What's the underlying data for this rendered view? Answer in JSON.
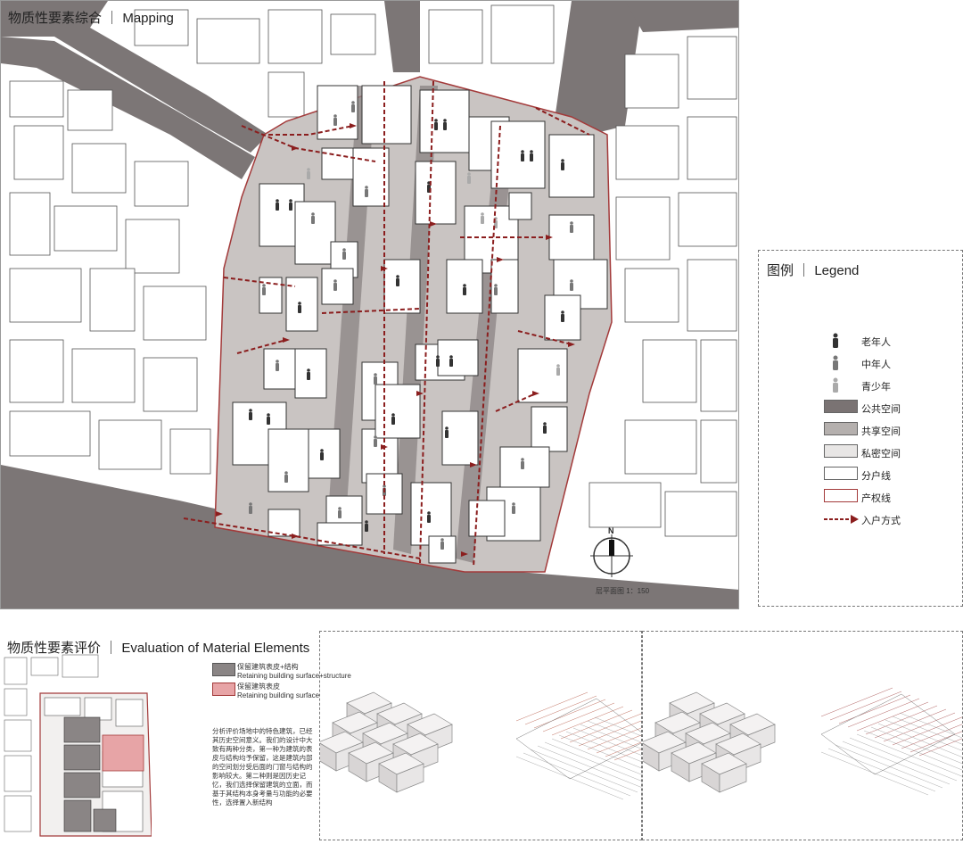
{
  "mapping": {
    "title": "物质性要素综合 ｜ Mapping",
    "scale_note": "层平面图  1：150",
    "north": "N"
  },
  "legend": {
    "title": "图例 ｜ Legend",
    "items": [
      {
        "label": "老年人",
        "kind": "person",
        "color": "#333333"
      },
      {
        "label": "中年人",
        "kind": "person",
        "color": "#777777"
      },
      {
        "label": "青少年",
        "kind": "person",
        "color": "#aaaaaa"
      },
      {
        "label": "公共空间",
        "kind": "swatch",
        "color": "#7a7373"
      },
      {
        "label": "共享空间",
        "kind": "swatch",
        "color": "#b5b0ae"
      },
      {
        "label": "私密空间",
        "kind": "swatch",
        "color": "#e8e6e5"
      },
      {
        "label": "分户线",
        "kind": "swatch",
        "color": "#ffffff"
      },
      {
        "label": "产权线",
        "kind": "redline",
        "color": "#a33a3a"
      },
      {
        "label": "入户方式",
        "kind": "arrow",
        "color": "#8b1e1e"
      }
    ]
  },
  "evaluation": {
    "title": "物质性要素评价 ｜ Evaluation of Material Elements",
    "legend_1_cn": "保留建筑表皮+结构",
    "legend_1_en": "Retaining building surface+structure",
    "legend_2_cn": "保留建筑表皮",
    "legend_2_en": "Retaining building surface",
    "color_1": "#8a8585",
    "color_2": "#e7a4a6",
    "description": "分析评价场地中的特色建筑，已经其历史空间意义。我们的设计中大致有两种分类，第一种为建筑的表皮与结构均予保留，这是建筑内部的空间划分受后面的门窗与结构的影响较大。第二种则是因历史记忆，我们选择保留建筑的立面，而基于其结构本身考量与功能的必要性，选择置入新结构"
  }
}
